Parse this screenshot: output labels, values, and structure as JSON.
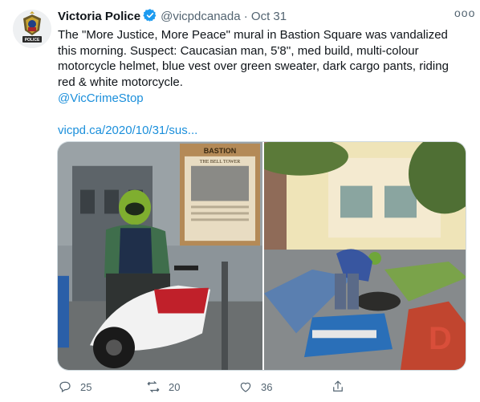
{
  "tweet": {
    "display_name": "Victoria Police",
    "handle": "@vicpdcanada",
    "separator": "·",
    "date": "Oct 31",
    "more_label": "ooo",
    "body_text": "The \"More Justice, More Peace\" mural in Bastion Square was vandalized this morning. Suspect: Caucasian man, 5'8'', med build, multi-colour motorcycle helmet, blue vest over green sweater, dark cargo pants, riding red & white motorcycle.",
    "mention": "@VicCrimeStop",
    "url": "vicpd.ca/2020/10/31/sus...",
    "badge_word": "POLICE",
    "photo1_sign_title": "BASTION",
    "photo1_poster_heading": "THE BELL TOWER",
    "actions": {
      "replies": "25",
      "retweets": "20",
      "likes": "36"
    },
    "icons": {
      "verified": "verified-badge-icon",
      "reply": "reply-icon",
      "retweet": "retweet-icon",
      "like": "heart-icon",
      "share": "share-icon"
    },
    "colors": {
      "accent": "#1b8fdb",
      "verified": "#1d9bf0",
      "secondary_text": "#536471"
    }
  }
}
